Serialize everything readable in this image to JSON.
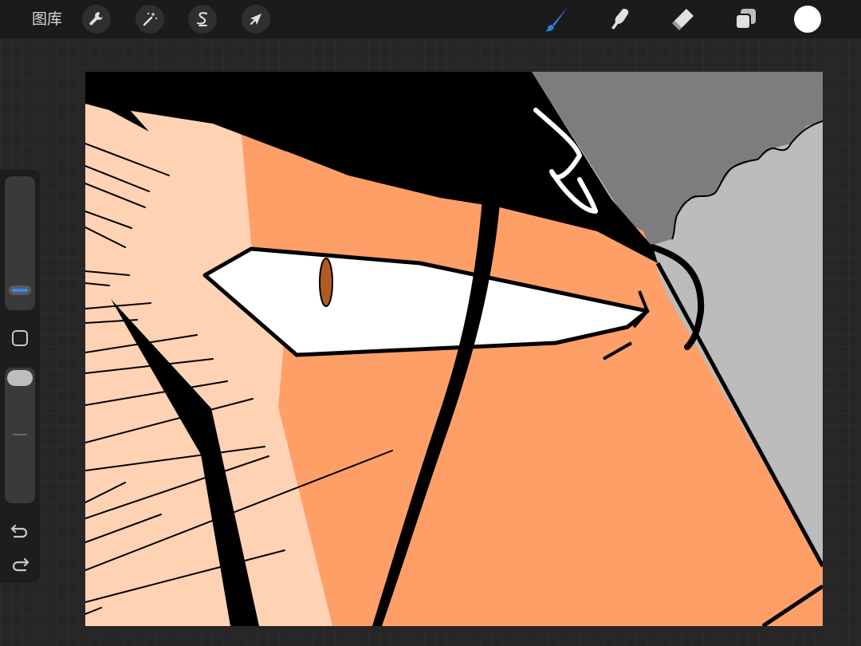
{
  "topbar": {
    "gallery_label": "图库",
    "left_tools": [
      {
        "name": "actions",
        "icon": "wrench-icon"
      },
      {
        "name": "adjustments",
        "icon": "magic-wand-icon"
      },
      {
        "name": "selection",
        "icon": "selection-s-icon"
      },
      {
        "name": "transform",
        "icon": "arrow-cursor-icon"
      }
    ],
    "right_tools": [
      {
        "name": "brush",
        "icon": "brush-icon",
        "active": true
      },
      {
        "name": "smudge",
        "icon": "smudge-finger-icon",
        "active": false
      },
      {
        "name": "eraser",
        "icon": "eraser-icon",
        "active": false
      },
      {
        "name": "layers",
        "icon": "layers-icon",
        "active": false
      }
    ],
    "current_color": "#ffffff"
  },
  "sidebar": {
    "brush_size_level": 0.18,
    "opacity_level": 1.0,
    "modify_icon": "square-modify-icon",
    "undo_icon": "undo-icon",
    "redo_icon": "redo-icon"
  },
  "colors": {
    "accent": "#2f7fe8",
    "ui_background": "#262626",
    "toolbar": "#1b1b1b",
    "skin_dark": "#ff9f68",
    "skin_light": "#ffd2b4",
    "hair": "#000000",
    "background_grey": "#bcbcbc",
    "background_dark_grey": "#7d7d7d",
    "iris": "#b25a24"
  }
}
